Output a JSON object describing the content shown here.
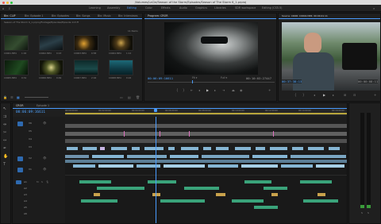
{
  "app": {
    "window_title": "/Volumes/LaCie/Season of the Storm/Episodes/Season of The Storm 6_1.prproj"
  },
  "workspaces": [
    "Learning",
    "Assembly",
    "Editing",
    "Color",
    "Effects",
    "Audio",
    "Graphics",
    "Libraries",
    "SDR workspace",
    "Editing (CS5.5)"
  ],
  "active_workspace": "Editing",
  "project_panel": {
    "tabs": [
      "Bin: CLIP",
      "Bin: Episode 1",
      "Bin: Episodes",
      "Bin: Songs",
      "Bin: Music",
      "Bin: Interviews"
    ],
    "path": "Season of The Storm 6_1.prproj/Footage/Episodes/Episode 113.ff",
    "items_count": "11 Items",
    "thumbs": [
      {
        "label": "C0001.MP4",
        "dur": "1:02"
      },
      {
        "label": "C0002.MP4",
        "dur": "0:43"
      },
      {
        "label": "C0003.MP4",
        "dur": "0:58"
      },
      {
        "label": "C0004.MP4",
        "dur": "1:12"
      },
      {
        "label": "C0005.MP4",
        "dur": "0:31"
      },
      {
        "label": "C0006.MP4",
        "dur": "0:49"
      },
      {
        "label": "C0007.MP4",
        "dur": "2:04"
      },
      {
        "label": "C0008.MP4",
        "dur": "0:22"
      }
    ]
  },
  "program_monitor": {
    "tab": "Program: CROR",
    "tc_left": "00:06:09:16611",
    "tc_right": "00:10:03:27447"
  },
  "source_monitor": {
    "tab": "Source: CROR: C0004.MP4: 00:00:41:11",
    "tc_left": "00:37:38:13",
    "tc_right": "00:00:08:11"
  },
  "timeline": {
    "tabs": [
      "CROR",
      "Episode 1"
    ],
    "tc": "00:06:09:16611",
    "ruler": [
      "00:00:00:00",
      "00:02:00:00",
      "00:04:00:00",
      "00:06:00:00",
      "00:08:00:00",
      "00:10:00:00",
      "00:12:00:00",
      "00:14:00:00",
      "00:16:00:00"
    ],
    "tracks": [
      "V6",
      "V5",
      "V4",
      "V3",
      "V2",
      "V1",
      "A1",
      "A2",
      "A3",
      "A4",
      "A5",
      "A6"
    ]
  },
  "colors": {
    "accent": "#4a9cff",
    "video_clip": "#86b6d4",
    "audio_clip": "#3aa37a",
    "title_clip": "#c7b5e3",
    "playhead": "#4a9cff"
  }
}
